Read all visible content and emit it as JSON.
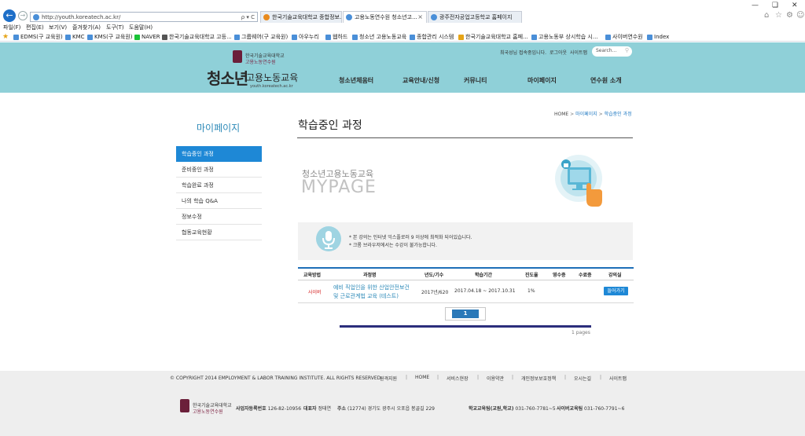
{
  "browser": {
    "url": "http://youth.koreatech.ac.kr/",
    "address_tools": "ρ ▾ C",
    "tabs": [
      {
        "title": "한국기술교육대학교 종합정보..."
      },
      {
        "title": "고용노동연수원 청소년고..."
      },
      {
        "title": "광주전자공업고등학교 홈페이지"
      }
    ],
    "menu": [
      "파일(F)",
      "편집(E)",
      "보기(V)",
      "즐겨찾기(A)",
      "도구(T)",
      "도움말(H)"
    ],
    "favorites": [
      "EDMS(구 교육원)",
      "KMC",
      "KMS(구 교육원)",
      "NAVER",
      "한국기술교육대학교 고등...",
      "그룹웨어(구 교육원)",
      "아우누리",
      "웹하드",
      "청소년 고용노동교육",
      "종합관리 시스템",
      "한국기술교육대학교 홈페...",
      "고용노동부 상시학습 시...",
      "사이버연수원",
      "Index"
    ]
  },
  "header": {
    "inst_name_1": "한국기술교육대학교",
    "inst_name_2": "고용노동연수원",
    "brand_big": "청소년",
    "brand_small": "고용노동교육",
    "brand_url": "youth.koreatech.ac.kr",
    "welcome": "최국성님 접속중입니다.",
    "logout": "로그아웃",
    "sitemap": "사이트맵",
    "search_placeholder": "Search...",
    "nav": [
      "청소년체움터",
      "교육안내/신청",
      "커뮤니티",
      "마이페이지",
      "연수원 소개"
    ]
  },
  "sidebar": {
    "title": "마이페이지",
    "items": [
      "학습중인 과정",
      "준비중인 과정",
      "학습완료 과정",
      "나의 학습 Q&A",
      "정보수정",
      "협동교육현황"
    ]
  },
  "main": {
    "breadcrumb": {
      "home": "HOME",
      "sep": ">",
      "section": "마이페이지",
      "current": "학습중인 과정"
    },
    "title": "학습중인 과정",
    "mypage_sub": "청소년고용노동교육",
    "mypage_big": "MYPAGE",
    "notice_1": "* 본 강의는 인터넷 익스플로러 9 이상에 최적화 되어있습니다.",
    "notice_2": "* 크롬 브라우저에서는 수강이 불가능합니다.",
    "table": {
      "headers": [
        "교육방법",
        "과정명",
        "년도/기수",
        "학습기간",
        "진도율",
        "영수증",
        "수료증",
        "강의실"
      ],
      "rows": [
        {
          "method": "사이버",
          "course_line1": "예비 직업인을 위한 산업안전보건",
          "course_line2": "및 근로관계법 교육 (테스트)",
          "year": "2017년/620",
          "period": "2017.04.18 ~ 2017.10.31",
          "progress": "1%",
          "button": "들어가기"
        }
      ]
    },
    "pagination": {
      "current": "1",
      "pages_label": "1 pages"
    }
  },
  "footer": {
    "copyright": "© COPYRIGHT 2014 EMPLOYMENT & LABOR TRAINING INSTITUTE. ALL RIGHTS RESERVED.",
    "links": [
      "원격지원",
      "HOME",
      "서비스현장",
      "이용약관",
      "개인정보보호정책",
      "오시는길",
      "사이트맵"
    ],
    "inst_name_1": "한국기술교육대학교",
    "inst_name_2": "고용노동연수원",
    "biz_label": "사업자등록번호",
    "biz_value": "126-82-10956",
    "ceo_label": "대표자",
    "ceo_value": "정태연",
    "addr_label": "주소",
    "addr_value": "(12774) 경기도 광주시 오포읍 봉골길 229",
    "school_label": "학교교육팀(교원,학교)",
    "school_value": "031-760-7781~5",
    "cyber_label": "사이버교육팀",
    "cyber_value": "031-760-7791~6"
  },
  "colors": {
    "header_bg": "#8fd0d8",
    "sidebar_active": "#1e88d6",
    "accent_blue": "#2d8ab8",
    "pager_bar": "#2b2e7c",
    "cyber_red": "#d42020"
  }
}
